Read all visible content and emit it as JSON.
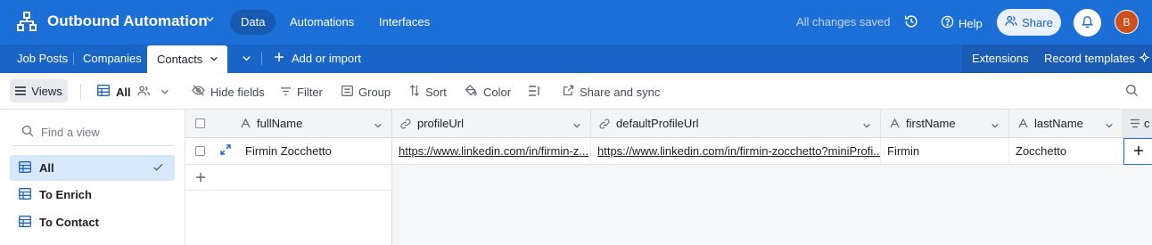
{
  "app": {
    "base_name": "Outbound Automation",
    "nav": [
      "Data",
      "Automations",
      "Interfaces"
    ],
    "saved_status": "All changes saved",
    "help_label": "Help",
    "share_label": "Share",
    "avatar_initial": "B"
  },
  "tabs": {
    "items": [
      "Job Posts",
      "Companies",
      "Contacts"
    ],
    "add_label": "Add or import",
    "extensions_label": "Extensions",
    "record_templates_label": "Record templates"
  },
  "toolbar": {
    "views_label": "Views",
    "current_view": "All",
    "hide_fields": "Hide fields",
    "filter": "Filter",
    "group": "Group",
    "sort": "Sort",
    "color": "Color",
    "share_sync": "Share and sync"
  },
  "sidebar": {
    "find_placeholder": "Find a view",
    "views": [
      "All",
      "To Enrich",
      "To Contact"
    ]
  },
  "grid": {
    "columns": [
      "fullName",
      "profileUrl",
      "defaultProfileUrl",
      "firstName",
      "lastName"
    ],
    "partial_column": "c",
    "rows": [
      {
        "fullName": "Firmin Zocchetto",
        "profileUrl": "https://www.linkedin.com/in/firmin-z...",
        "defaultProfileUrl": "https://www.linkedin.com/in/firmin-zocchetto?miniProfi...",
        "firstName": "Firmin",
        "lastName": "Zocchetto"
      }
    ]
  },
  "colors": {
    "topbar": "#1b6fd6",
    "tabbar": "#1864c7",
    "avatar": "#cc4f1e",
    "active_view": "#d6e8fb"
  }
}
